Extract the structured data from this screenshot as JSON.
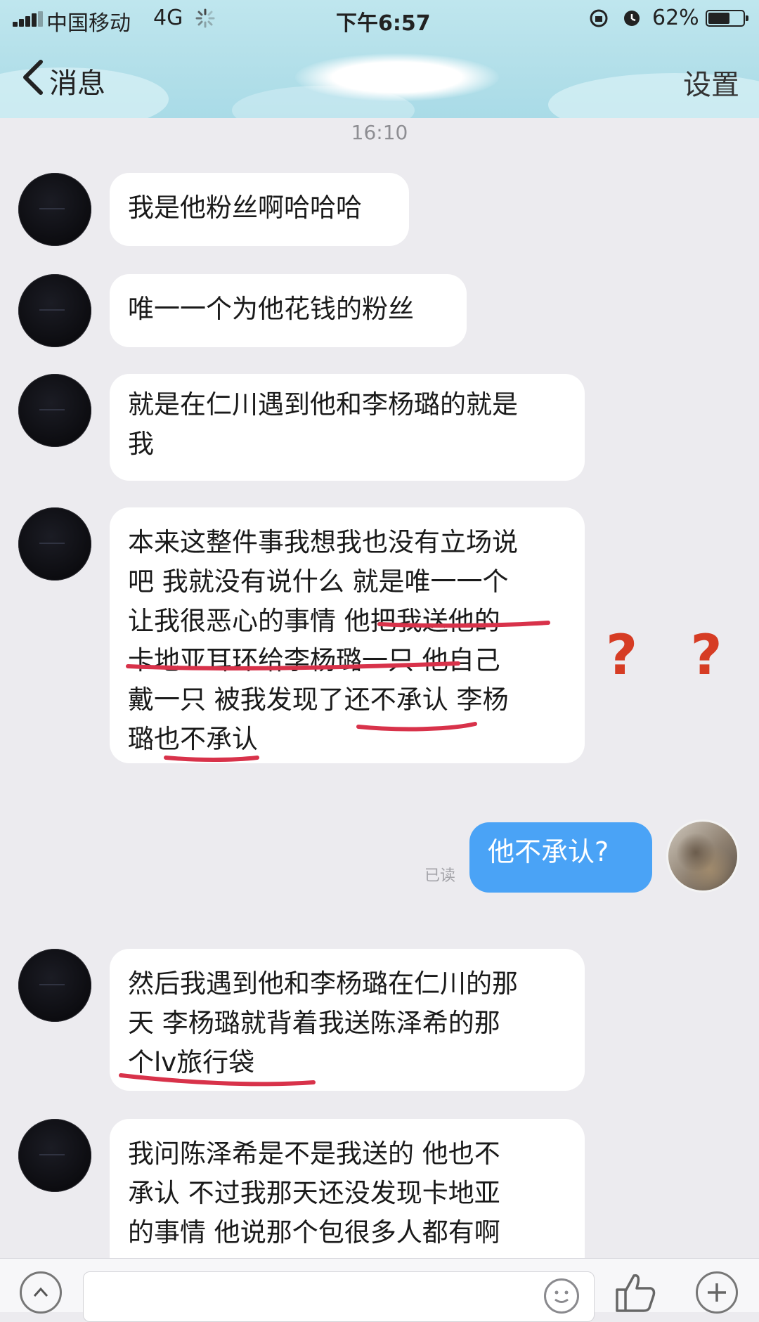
{
  "status_bar": {
    "carrier": "中国移动",
    "network": "4G",
    "time": "下午6:57",
    "battery": "62%",
    "battery_level": 0.62
  },
  "nav": {
    "back_label": "消息",
    "settings_label": "设置"
  },
  "chat": {
    "timestamp": "16:10",
    "messages": [
      {
        "from": "other",
        "text": "我是他粉丝啊哈哈哈"
      },
      {
        "from": "other",
        "text": "唯一一个为他花钱的粉丝"
      },
      {
        "from": "other",
        "text": "就是在仁川遇到他和李杨璐的就是\n我"
      },
      {
        "from": "other",
        "text": "本来这整件事我想我也没有立场说\n吧 我就没有说什么 就是唯一一个\n让我很恶心的事情 他把我送他的\n卡地亚耳环给李杨璐一只 他自己\n戴一只 被我发现了还不承认 李杨\n璐也不承认"
      },
      {
        "from": "self",
        "text": "他不承认?",
        "read_label": "已读"
      },
      {
        "from": "other",
        "text": "然后我遇到他和李杨璐在仁川的那\n天 李杨璐就背着我送陈泽希的那\n个lv旅行袋"
      },
      {
        "from": "other",
        "text": "我问陈泽希是不是我送的 他也不\n承认 不过我那天还没发现卡地亚\n的事情 他说那个包很多人都有啊\n我就信了他"
      }
    ]
  },
  "annotation": {
    "question_marks": "? ?",
    "underline_color": "#d8324a",
    "question_color": "#d63c24"
  },
  "colors": {
    "self_bubble": "#4aa3f6",
    "header_bg": "#b2dfe9",
    "chat_bg": "#ecebef"
  }
}
